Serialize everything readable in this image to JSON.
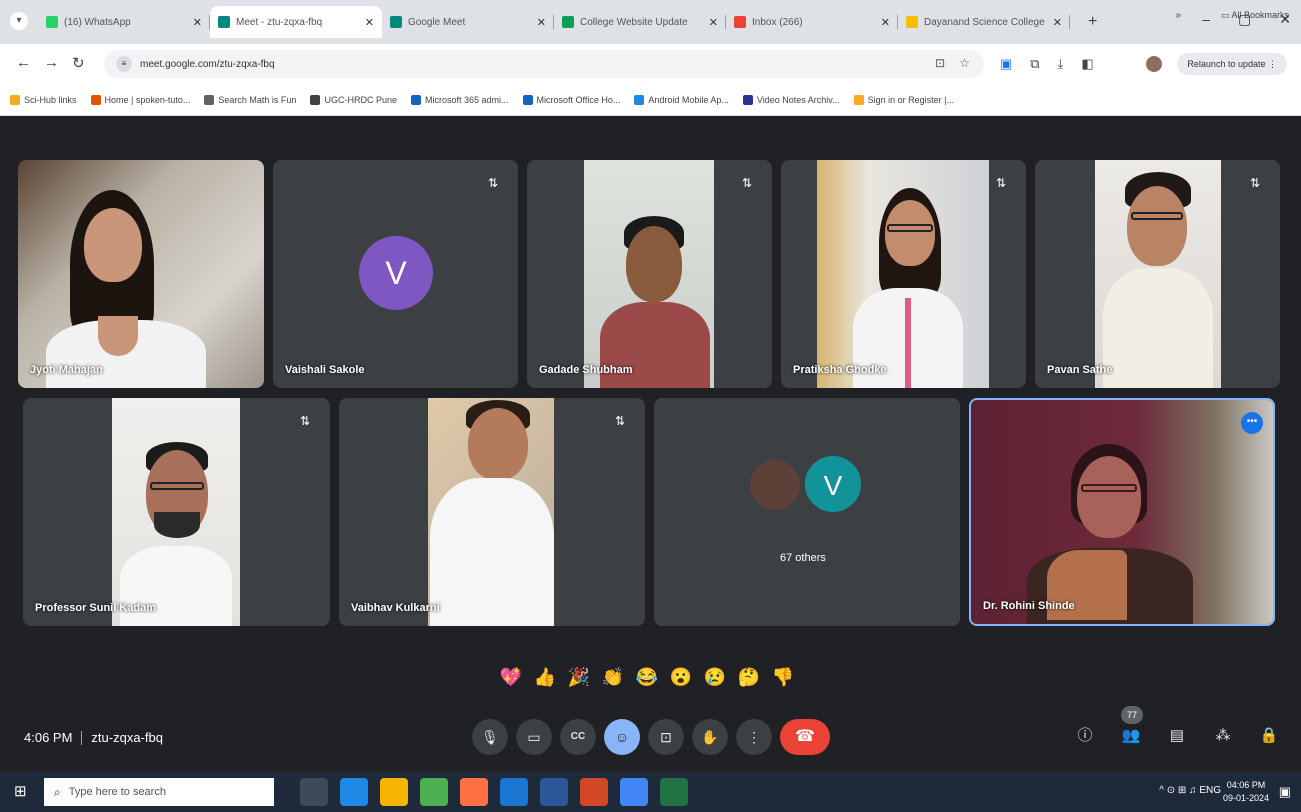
{
  "browser": {
    "tabs": [
      {
        "title": "(16) WhatsApp",
        "color": "#25d366",
        "active": false
      },
      {
        "title": "Meet - ztu-zqxa-fbq",
        "color": "#00897b",
        "active": true
      },
      {
        "title": "Google Meet",
        "color": "#00897b",
        "active": false
      },
      {
        "title": "College Website Update",
        "color": "#0f9d58",
        "active": false
      },
      {
        "title": "Inbox (266)",
        "color": "#ea4335",
        "active": false
      },
      {
        "title": "Dayanand Science College",
        "color": "#fbbc04",
        "active": false
      }
    ],
    "url": "meet.google.com/ztu-zqxa-fbq",
    "relaunch_label": "Relaunch to update",
    "bookmarks": [
      {
        "label": "Sci-Hub links",
        "color": "#f9a825"
      },
      {
        "label": "Home | spoken-tuto...",
        "color": "#e65100"
      },
      {
        "label": "Search Math is Fun",
        "color": "#616161"
      },
      {
        "label": "UGC-HRDC Pune",
        "color": "#424242"
      },
      {
        "label": "Microsoft 365 admi...",
        "color": "#1565c0"
      },
      {
        "label": "Microsoft Office Ho...",
        "color": "#1565c0"
      },
      {
        "label": "Android Mobile Ap...",
        "color": "#1e88e5"
      },
      {
        "label": "Video Notes Archiv...",
        "color": "#283593"
      },
      {
        "label": "Sign in or Register |...",
        "color": "#f9a825"
      }
    ],
    "bookmarks_more": "»",
    "all_bookmarks": "All Bookmarks"
  },
  "meet": {
    "participants": [
      {
        "name": "Jyoti Mahajan"
      },
      {
        "name": "Vaishali Sakole",
        "avatar_letter": "V"
      },
      {
        "name": "Gadade Shubham"
      },
      {
        "name": "Pratiksha Ghodke"
      },
      {
        "name": "Pavan Sathe"
      },
      {
        "name": "Professor Sunil Kadam"
      },
      {
        "name": "Vaibhav Kulkarni"
      },
      {
        "name": "Dr. Rohini Shinde"
      }
    ],
    "others": {
      "avatar_letter": "V",
      "label": "67 others"
    },
    "pin_glyph": "⇅",
    "more_glyph": "•••",
    "reactions": [
      "💖",
      "👍",
      "🎉",
      "👏",
      "😂",
      "😮",
      "😢",
      "🤔",
      "👎"
    ],
    "time": "4:06 PM",
    "meeting_code": "ztu-zqxa-fbq",
    "participant_count": "77",
    "controls": {
      "mic": "🎙",
      "camera": "▭",
      "captions": "CC",
      "raise_hand": "☺",
      "present": "⊡",
      "hand": "✋",
      "more": "⋮",
      "end_call": "☎"
    }
  },
  "taskbar": {
    "search_placeholder": "Type here to search",
    "tray": "^ ⊙ ⊞ ♫ ENG",
    "time": "04:06 PM",
    "date": "09-01-2024",
    "apps": [
      "#3c4a5c",
      "#1e88e5",
      "#f4b400",
      "#4caf50",
      "#ff7043",
      "#1976d2",
      "#2b579a",
      "#d24726",
      "#4285f4",
      "#217346"
    ]
  }
}
